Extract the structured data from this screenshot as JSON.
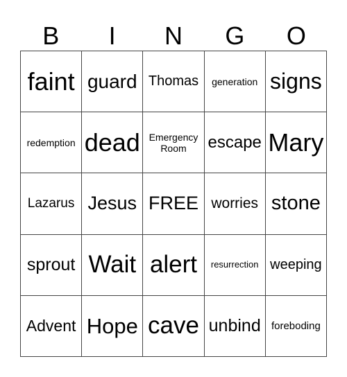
{
  "header": [
    "B",
    "I",
    "N",
    "G",
    "O"
  ],
  "cells": [
    {
      "text": "faint",
      "size": 36
    },
    {
      "text": "guard",
      "size": 28
    },
    {
      "text": "Thomas",
      "size": 20
    },
    {
      "text": "generation",
      "size": 14
    },
    {
      "text": "signs",
      "size": 32
    },
    {
      "text": "redemption",
      "size": 14
    },
    {
      "text": "dead",
      "size": 36
    },
    {
      "text": "Emergency Room",
      "size": 14
    },
    {
      "text": "escape",
      "size": 24
    },
    {
      "text": "Mary",
      "size": 36
    },
    {
      "text": "Lazarus",
      "size": 19
    },
    {
      "text": "Jesus",
      "size": 27
    },
    {
      "text": "FREE",
      "size": 27
    },
    {
      "text": "worries",
      "size": 21
    },
    {
      "text": "stone",
      "size": 29
    },
    {
      "text": "sprout",
      "size": 25
    },
    {
      "text": "Wait",
      "size": 35
    },
    {
      "text": "alert",
      "size": 35
    },
    {
      "text": "resurrection",
      "size": 13
    },
    {
      "text": "weeping",
      "size": 20
    },
    {
      "text": "Advent",
      "size": 23
    },
    {
      "text": "Hope",
      "size": 31
    },
    {
      "text": "cave",
      "size": 35
    },
    {
      "text": "unbind",
      "size": 25
    },
    {
      "text": "foreboding",
      "size": 15
    }
  ]
}
